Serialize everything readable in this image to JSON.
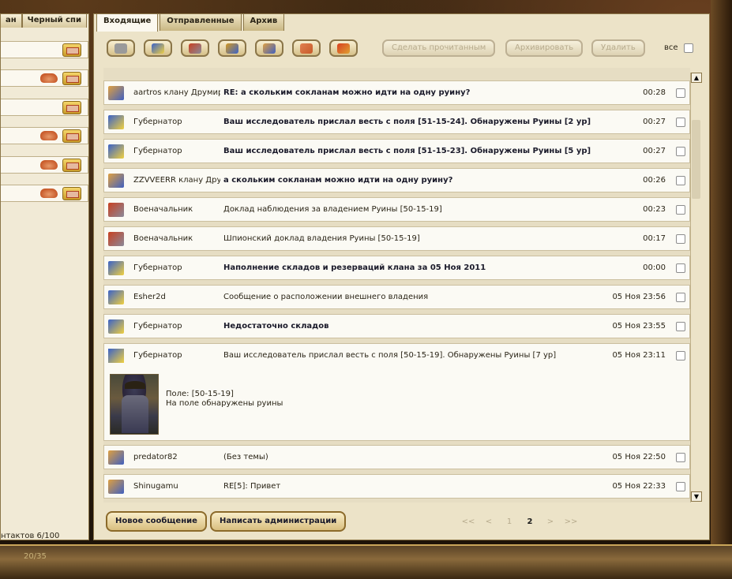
{
  "left_panel": {
    "tabs": [
      {
        "label": "ан"
      },
      {
        "label": "Черный спи"
      }
    ],
    "contacts_footer": "нтактов 6/100"
  },
  "tabs": [
    {
      "label": "Входящие",
      "active": true
    },
    {
      "label": "Отправленные",
      "active": false
    },
    {
      "label": "Архив",
      "active": false
    }
  ],
  "toolbar": {
    "icons": [
      "scroll-icon",
      "governor-flag-icon",
      "commander-sword-icon",
      "treasury-book-icon",
      "clan-icon",
      "alliance-handshake-icon",
      "admin-icon"
    ],
    "mark_read_label": "Сделать прочитанным",
    "archive_label": "Архивировать",
    "delete_label": "Удалить",
    "all_label": "все"
  },
  "messages": [
    {
      "icon": "clan-icon",
      "from": "aartros клану Друмир",
      "subject": "RE: а скольким сокланам можно идти на одну руину?",
      "time": "00:28",
      "bold": true
    },
    {
      "icon": "governor-flag-icon",
      "from": "Губернатор",
      "subject": "Ваш исследователь прислал весть с поля [51-15-24]. Обнаружены Руины [2 ур]",
      "time": "00:27",
      "bold": true
    },
    {
      "icon": "governor-flag-icon",
      "from": "Губернатор",
      "subject": "Ваш исследователь прислал весть с поля [51-15-23]. Обнаружены Руины [5 ур]",
      "time": "00:27",
      "bold": true
    },
    {
      "icon": "clan-icon",
      "from": "ZZVVEERR клану Дру",
      "subject": "а скольким сокланам можно идти на одну руину?",
      "time": "00:26",
      "bold": true
    },
    {
      "icon": "commander-sword-icon",
      "from": "Военачальник",
      "subject": "Доклад наблюдения за владением Руины [50-15-19]",
      "time": "00:23",
      "bold": false
    },
    {
      "icon": "commander-sword-icon",
      "from": "Военачальник",
      "subject": "Шпионский доклад владения Руины [50-15-19]",
      "time": "00:17",
      "bold": false
    },
    {
      "icon": "governor-flag-icon",
      "from": "Губернатор",
      "subject": "Наполнение складов и резерваций клана за 05 Ноя 2011",
      "time": "00:00",
      "bold": true
    },
    {
      "icon": "governor-flag-icon",
      "from": "Esher2d",
      "subject": "Сообщение о расположении внешнего владения",
      "time": "05 Ноя 23:56",
      "bold": false
    },
    {
      "icon": "governor-flag-icon",
      "from": "Губернатор",
      "subject": "Недостаточно складов",
      "time": "05 Ноя 23:55",
      "bold": true
    }
  ],
  "expanded_message": {
    "icon": "governor-flag-icon",
    "from": "Губернатор",
    "subject": "Ваш исследователь прислал весть с поля [50-15-19]. Обнаружены Руины [7 ур]",
    "time": "05 Ноя 23:11",
    "body_line1": "Поле: [50-15-19]",
    "body_line2": "На поле обнаружены руины"
  },
  "messages_after": [
    {
      "icon": "clan-icon",
      "from": "predator82",
      "subject": "(Без темы)",
      "time": "05 Ноя 22:50",
      "bold": false
    },
    {
      "icon": "clan-icon",
      "from": "Shinugamu",
      "subject": "RE[5]: Привет",
      "time": "05 Ноя 22:33",
      "bold": false
    }
  ],
  "footer": {
    "new_message_label": "Новое сообщение",
    "write_admin_label": "Написать администрации",
    "pager": [
      "<<",
      "<",
      "1",
      "2",
      ">",
      ">>"
    ],
    "current_page": "2"
  },
  "bottom_bar_text": "20/35",
  "colors": {
    "panel_bg": "#ece3c8",
    "row_bg": "#fbfaf4",
    "accent_gold": "#c9a65a",
    "disabled_text": "#b7ab8d"
  }
}
